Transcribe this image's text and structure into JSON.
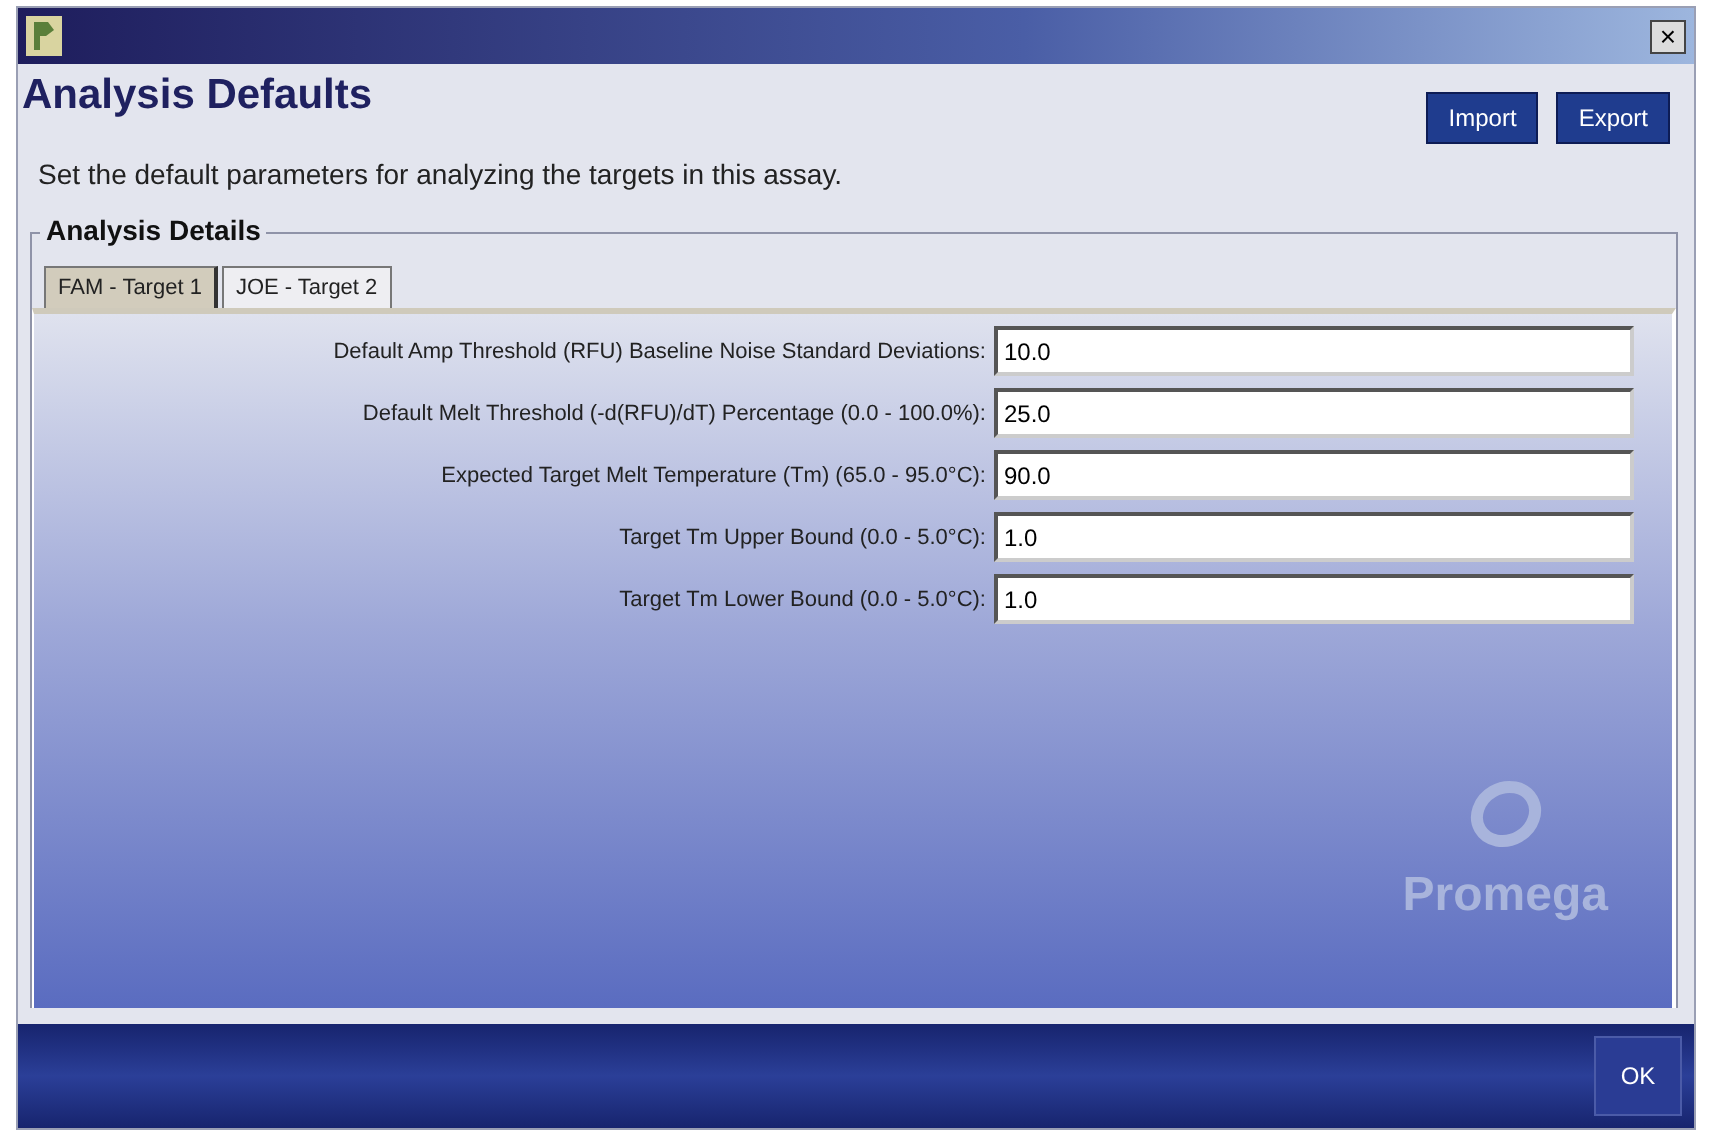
{
  "window": {
    "close": "×"
  },
  "header": {
    "title": "Analysis Defaults",
    "buttons": [
      "Import",
      "Export"
    ],
    "description": "Set the default parameters for analyzing the targets in this assay."
  },
  "group": {
    "title": "Analysis Details"
  },
  "tabs": [
    {
      "label": "FAM - Target 1",
      "selected": true
    },
    {
      "label": "JOE - Target 2",
      "selected": false
    }
  ],
  "fields": [
    {
      "label": "Default Amp Threshold (RFU) Baseline Noise Standard Deviations:",
      "value": "10.0"
    },
    {
      "label": "Default Melt Threshold (-d(RFU)/dT) Percentage (0.0 - 100.0%):",
      "value": "25.0"
    },
    {
      "label": "Expected Target Melt Temperature (Tm) (65.0 - 95.0°C):",
      "value": "90.0"
    },
    {
      "label": "Target Tm Upper Bound (0.0 - 5.0°C):",
      "value": "1.0"
    },
    {
      "label": "Target Tm Lower Bound (0.0 - 5.0°C):",
      "value": "1.0"
    }
  ],
  "logo": {
    "text": "Promega"
  },
  "footer": {
    "button": "OK"
  }
}
